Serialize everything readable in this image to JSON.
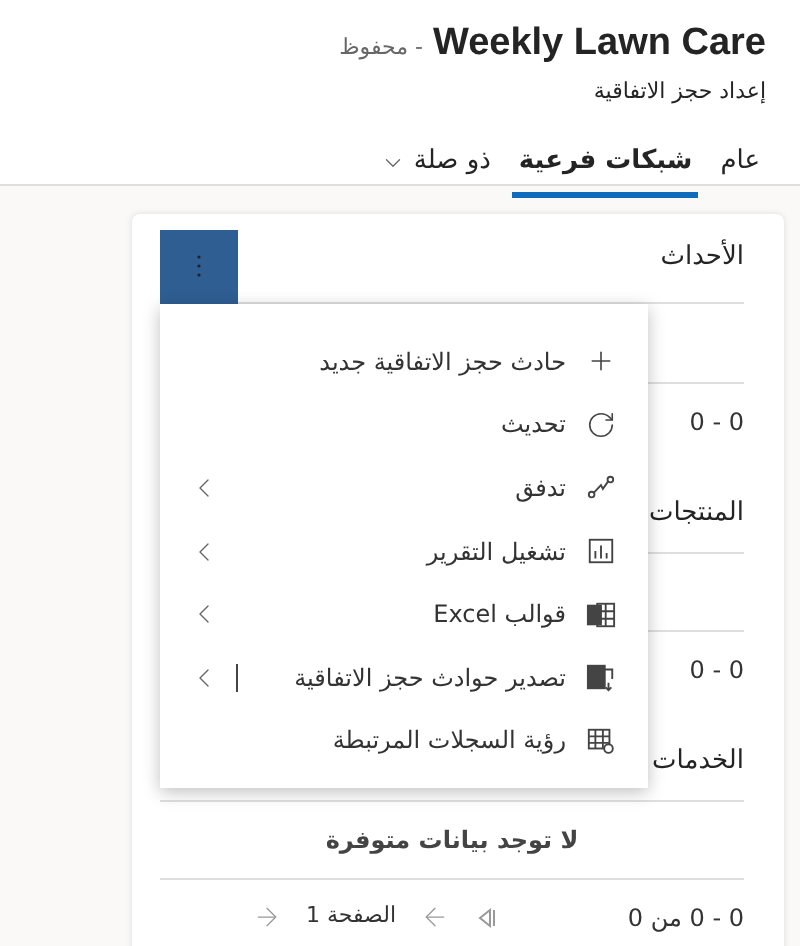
{
  "header": {
    "title": "Weekly Lawn Care",
    "save_status": "- محفوظ",
    "subtitle": "إعداد حجز الاتفاقية"
  },
  "tabs": [
    {
      "label": "عام",
      "selected": false,
      "kind": "tab"
    },
    {
      "label": "شبكات فرعية",
      "selected": true,
      "kind": "tab"
    },
    {
      "label": "ذو صلة",
      "selected": false,
      "kind": "dropdown"
    }
  ],
  "menu_open": true,
  "sections": [
    {
      "title": "الأحداث",
      "pager_range": "0 - 0"
    },
    {
      "title": "المنتجات",
      "pager_range": "0 - 0"
    },
    {
      "title": "الخدمات",
      "empty_message": "لا توجد بيانات متوفرة",
      "pager_range": "0 - 0 من 0",
      "page": "الصفحة 1"
    }
  ],
  "menu": [
    {
      "kind": "plus",
      "label": "حادث حجز الاتفاقية جديد",
      "submenu": false,
      "split": false
    },
    {
      "kind": "refresh",
      "label": "تحديث",
      "submenu": false,
      "split": false
    },
    {
      "kind": "flow",
      "label": "تدفق",
      "submenu": true,
      "split": false
    },
    {
      "kind": "report",
      "label": "تشغيل التقرير",
      "submenu": true,
      "split": false
    },
    {
      "kind": "excel-template",
      "label": "قوالب Excel",
      "submenu": true,
      "split": false
    },
    {
      "kind": "excel-export",
      "label": "تصدير حوادث حجز الاتفاقية",
      "submenu": true,
      "split": true
    },
    {
      "kind": "related",
      "label": "رؤية السجلات المرتبطة",
      "submenu": false,
      "split": false
    }
  ]
}
